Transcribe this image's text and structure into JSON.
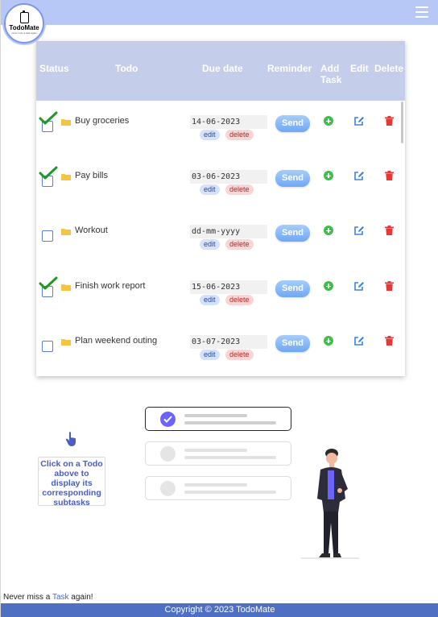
{
  "app": {
    "logo_name": "TodoMate",
    "logo_tagline": "never miss a task again"
  },
  "table": {
    "headers": {
      "status": "Status",
      "todo": "Todo",
      "due_date": "Due date",
      "reminder": "Reminder",
      "add_task_line1": "Add",
      "add_task_line2": "Task",
      "edit": "Edit",
      "delete": "Delete"
    },
    "rows": [
      {
        "title": "Buy groceries",
        "date": "14-06-2023",
        "checked": true
      },
      {
        "title": "Pay bills",
        "date": "03-06-2023",
        "checked": true
      },
      {
        "title": "Workout",
        "date": "dd-mm-yyyy",
        "checked": false
      },
      {
        "title": "Finish work report",
        "date": "15-06-2023",
        "checked": true
      },
      {
        "title": "Plan weekend outing",
        "date": "03-07-2023",
        "checked": false
      }
    ],
    "edit_badge": "edit",
    "delete_badge": "delete",
    "send_label": "Send"
  },
  "hint": {
    "text": "Click on a Todo above to display its corresponding subtasks"
  },
  "tagline": {
    "prefix": "Never miss a ",
    "link": "Task",
    "suffix": " again!"
  },
  "footer": {
    "copyright": "Copyright © 2023 TodoMate"
  },
  "colors": {
    "topbar": "#b7c8f7",
    "table_header": "#c4cde9",
    "footer": "#4f6fc2",
    "check_green": "#1e9a22",
    "add_green": "#3fbe4e",
    "edit_blue": "#3b82e6",
    "trash_red": "#e53935",
    "accent_violet": "#6c63ff"
  },
  "icons": [
    "hamburger-menu-icon",
    "folder-icon",
    "checkmark-icon",
    "plus-circle-icon",
    "edit-icon",
    "trash-icon",
    "pointing-hand-icon"
  ]
}
